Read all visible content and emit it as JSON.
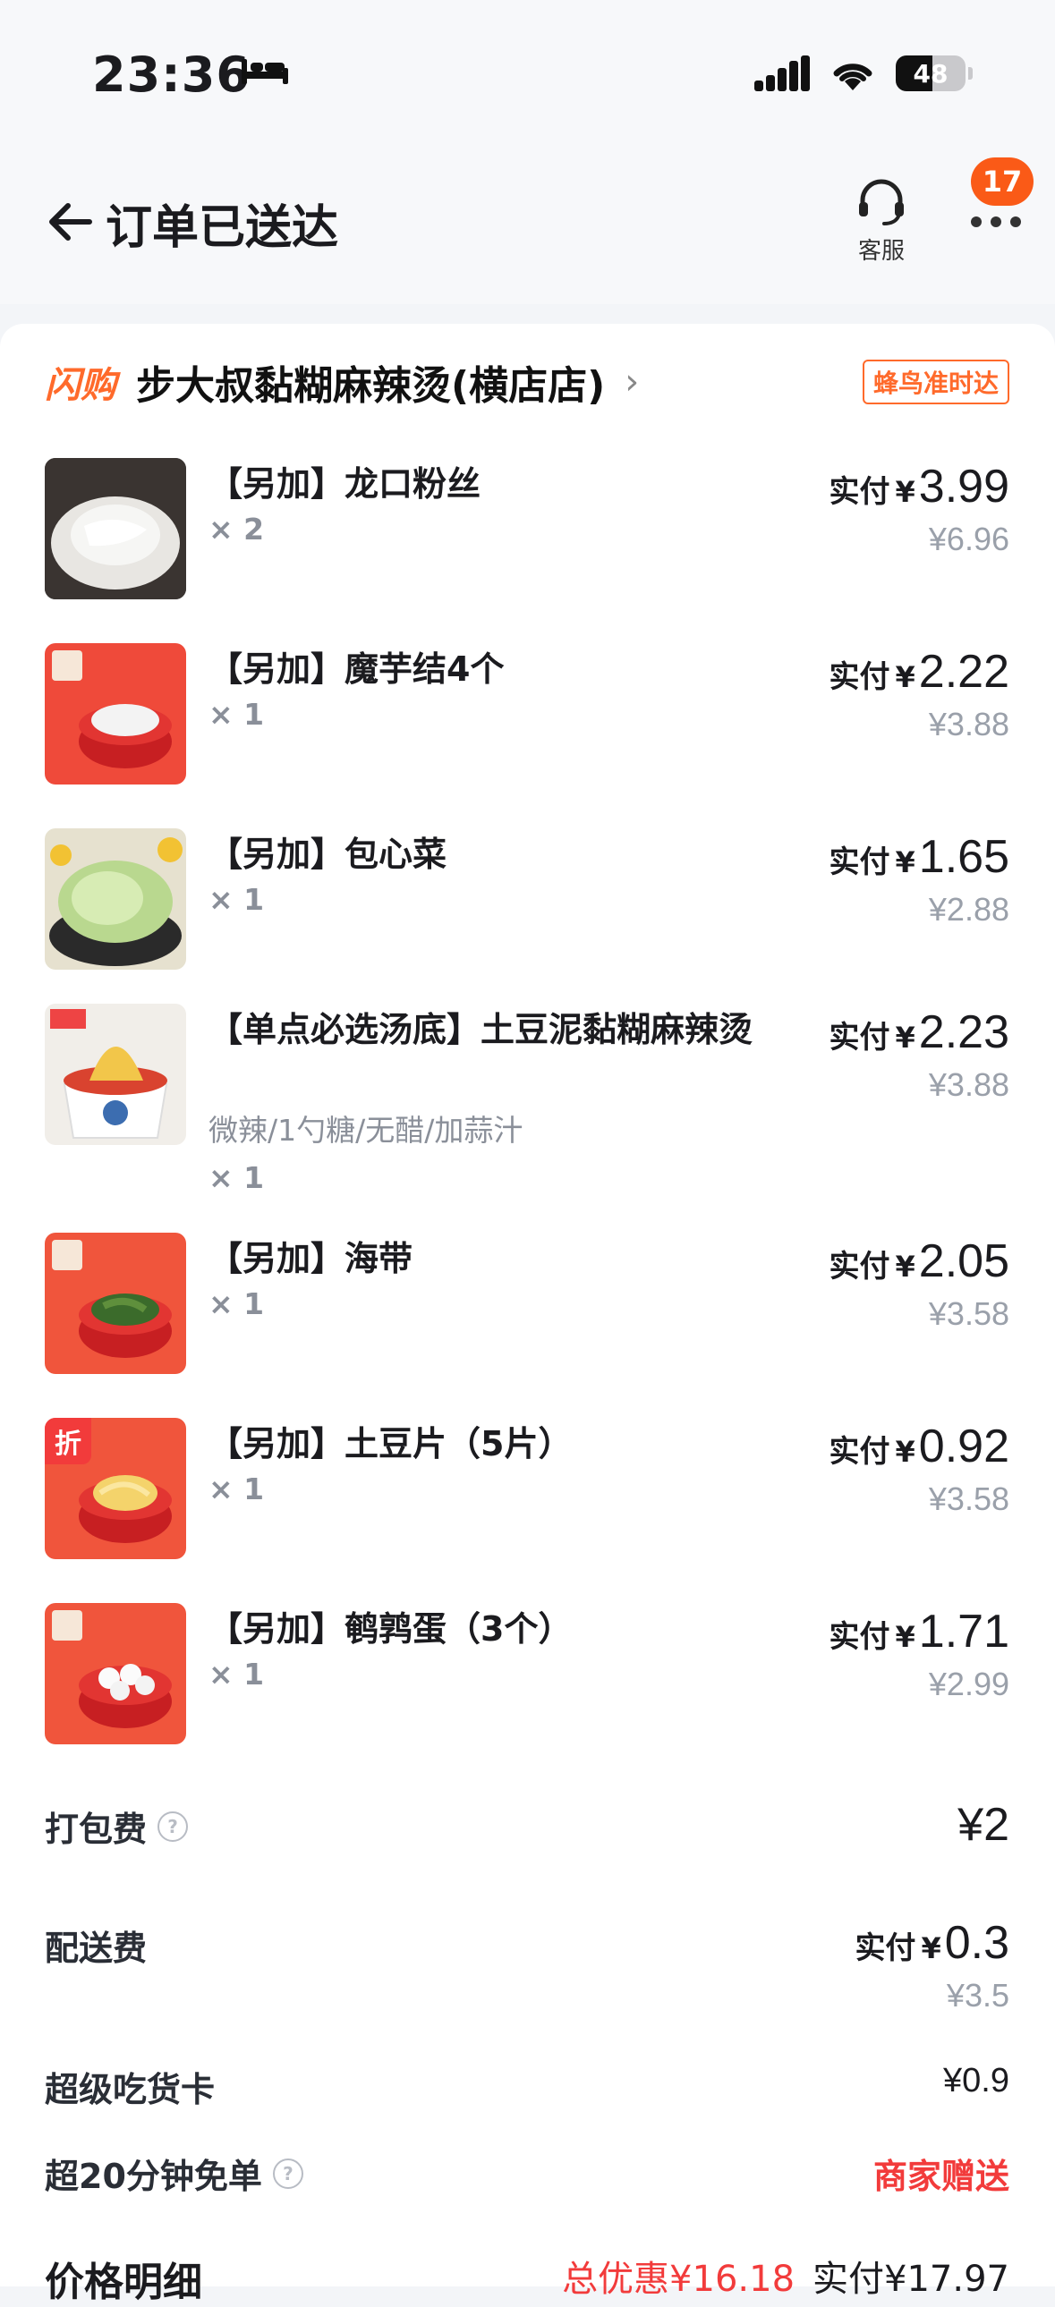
{
  "status_bar": {
    "time": "23:36",
    "battery": "48"
  },
  "header": {
    "title": "订单已送达",
    "service_label": "客服",
    "badge_count": "17"
  },
  "shop": {
    "tag": "闪购",
    "name": "步大叔黏糊麻辣烫(横店店)",
    "delivery_tag": "蜂鸟准时达"
  },
  "items": [
    {
      "name": "【另加】龙口粉丝",
      "qty": "× 2",
      "pay_label": "实付",
      "currency": "¥",
      "pay": "3.99",
      "original": "¥6.96"
    },
    {
      "name": "【另加】魔芋结4个",
      "qty": "× 1",
      "pay_label": "实付",
      "currency": "¥",
      "pay": "2.22",
      "original": "¥3.88"
    },
    {
      "name": "【另加】包心菜",
      "qty": "× 1",
      "pay_label": "实付",
      "currency": "¥",
      "pay": "1.65",
      "original": "¥2.88"
    },
    {
      "name": "【单点必选汤底】土豆泥黏糊麻辣烫",
      "spec": "微辣/1勺糖/无醋/加蒜汁",
      "qty": "× 1",
      "pay_label": "实付",
      "currency": "¥",
      "pay": "2.23",
      "original": "¥3.88"
    },
    {
      "name": "【另加】海带",
      "qty": "× 1",
      "pay_label": "实付",
      "currency": "¥",
      "pay": "2.05",
      "original": "¥3.58"
    },
    {
      "name": "【另加】土豆片（5片）",
      "qty": "× 1",
      "pay_label": "实付",
      "currency": "¥",
      "pay": "0.92",
      "original": "¥3.58",
      "badge": "折"
    },
    {
      "name": "【另加】鹌鹑蛋（3个）",
      "qty": "× 1",
      "pay_label": "实付",
      "currency": "¥",
      "pay": "1.71",
      "original": "¥2.99"
    }
  ],
  "fees": {
    "packing": {
      "label": "打包费",
      "value": "¥2"
    },
    "delivery": {
      "label": "配送费",
      "pay_label": "实付",
      "currency": "¥",
      "pay": "0.3",
      "original": "¥3.5"
    },
    "super_card": {
      "label": "超级吃货卡",
      "value": "¥0.9"
    },
    "free_order": {
      "label": "超20分钟免单",
      "value": "商家赠送"
    }
  },
  "summary": {
    "label": "价格明细",
    "saved": "总优惠¥16.18",
    "paid": "实付¥17.97"
  },
  "colors": {
    "accent": "#ff6a2b",
    "red": "#f23b3b",
    "badge": "#fa5a17"
  }
}
